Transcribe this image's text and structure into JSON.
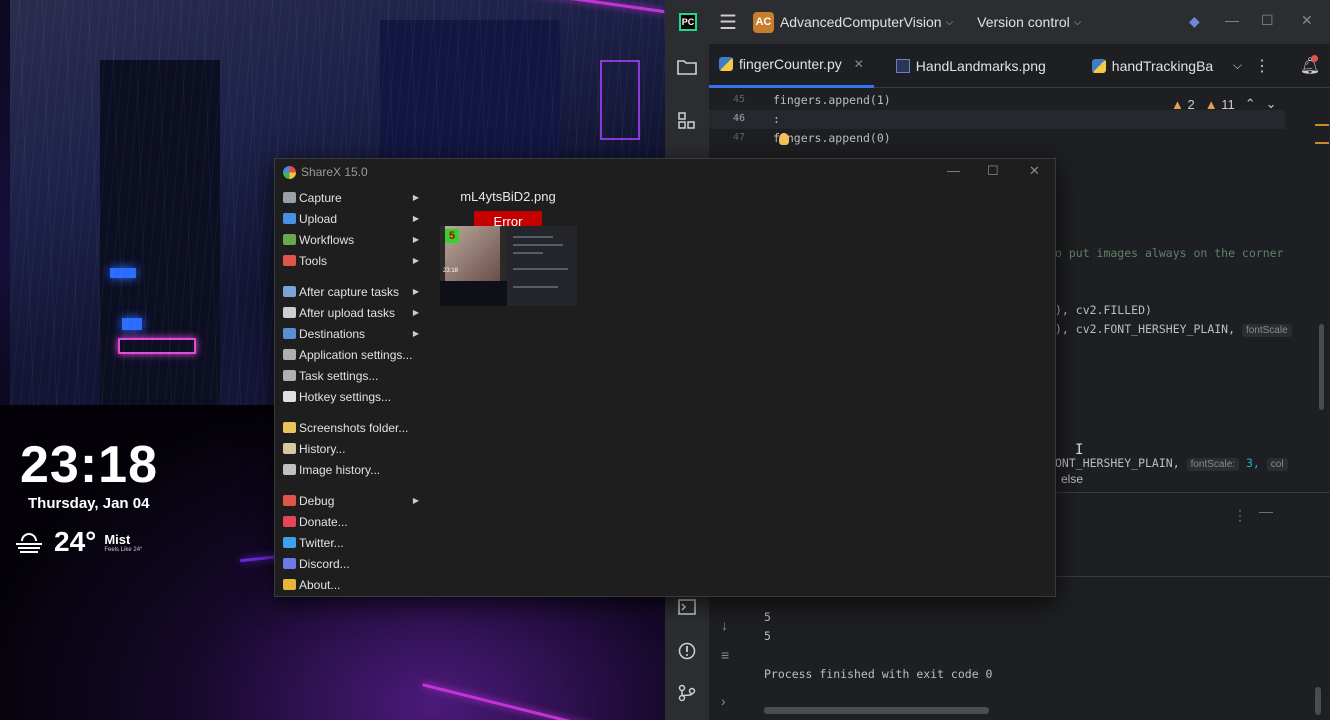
{
  "desktop": {
    "clock": {
      "time": "23:18",
      "date": "Thursday, Jan 04"
    },
    "weather": {
      "temperature": "24°",
      "condition": "Mist",
      "feels_like": "Feels Like 24°",
      "icon": "mist-icon"
    }
  },
  "ide": {
    "project_badge": "AC",
    "project_name": "AdvancedComputerVision",
    "vcs_label": "Version control",
    "tabs": [
      {
        "label": "fingerCounter.py",
        "icon": "python-file-icon",
        "active": true
      },
      {
        "label": "HandLandmarks.png",
        "icon": "image-file-icon",
        "active": false
      },
      {
        "label": "handTrackingBa",
        "icon": "python-file-icon",
        "active": false
      }
    ],
    "warnings": {
      "warning_count": "2",
      "weak_warning_count": "11"
    },
    "code_lines": [
      {
        "num": "45",
        "text": "fingers.append(1)"
      },
      {
        "num": "46",
        "text": ":"
      },
      {
        "num": "47",
        "text": "fingers.append(0)"
      }
    ],
    "code_fragments": {
      "comment": "o put images always on the corner",
      "filled": "), cv2.FILLED)",
      "hershey_1": "), cv2.FONT_HERSHEY_PLAIN,",
      "hershey_2": "ONT_HERSHEY_PLAIN,",
      "font_scale_hint": "fontScale:",
      "font_scale_hint_short": "fontScale",
      "font_scale_value": "3,",
      "col_hint": "col",
      "completion": "else"
    },
    "console_lines": [
      "5",
      "5",
      "5",
      "",
      "Process finished with exit code 0"
    ]
  },
  "sharex": {
    "title": "ShareX 15.0",
    "menu_groups": [
      [
        {
          "label": "Capture",
          "submenu": true,
          "icon_color": "#9aa0a8"
        },
        {
          "label": "Upload",
          "submenu": true,
          "icon_color": "#4a90e2"
        },
        {
          "label": "Workflows",
          "submenu": true,
          "icon_color": "#6aa84f"
        },
        {
          "label": "Tools",
          "submenu": true,
          "icon_color": "#e0554a"
        }
      ],
      [
        {
          "label": "After capture tasks",
          "submenu": true,
          "icon_color": "#7aa3d6"
        },
        {
          "label": "After upload tasks",
          "submenu": true,
          "icon_color": "#cfcfcf"
        },
        {
          "label": "Destinations",
          "submenu": true,
          "icon_color": "#5a8fd6"
        },
        {
          "label": "Application settings...",
          "submenu": false,
          "icon_color": "#b0b0b0"
        },
        {
          "label": "Task settings...",
          "submenu": false,
          "icon_color": "#b0b0b0"
        },
        {
          "label": "Hotkey settings...",
          "submenu": false,
          "icon_color": "#e0e0e0"
        }
      ],
      [
        {
          "label": "Screenshots folder...",
          "submenu": false,
          "icon_color": "#e8c45a"
        },
        {
          "label": "History...",
          "submenu": false,
          "icon_color": "#d8c8a0"
        },
        {
          "label": "Image history...",
          "submenu": false,
          "icon_color": "#c0c0c0"
        }
      ],
      [
        {
          "label": "Debug",
          "submenu": true,
          "icon_color": "#e0554a"
        },
        {
          "label": "Donate...",
          "submenu": false,
          "icon_color": "#e8455a"
        },
        {
          "label": "Twitter...",
          "submenu": false,
          "icon_color": "#3ea1ec"
        },
        {
          "label": "Discord...",
          "submenu": false,
          "icon_color": "#6b7ae8"
        },
        {
          "label": "About...",
          "submenu": false,
          "icon_color": "#e8b53a"
        }
      ]
    ],
    "task": {
      "filename": "mL4ytsBiD2.png",
      "status": "Error",
      "thumb_count": "5",
      "thumb_time": "23:18"
    }
  },
  "colors": {
    "error_red": "#c40000",
    "ide_bg": "#1e1f22",
    "sharex_bg": "#1e1e1e",
    "accent_blue": "#3574f0"
  }
}
